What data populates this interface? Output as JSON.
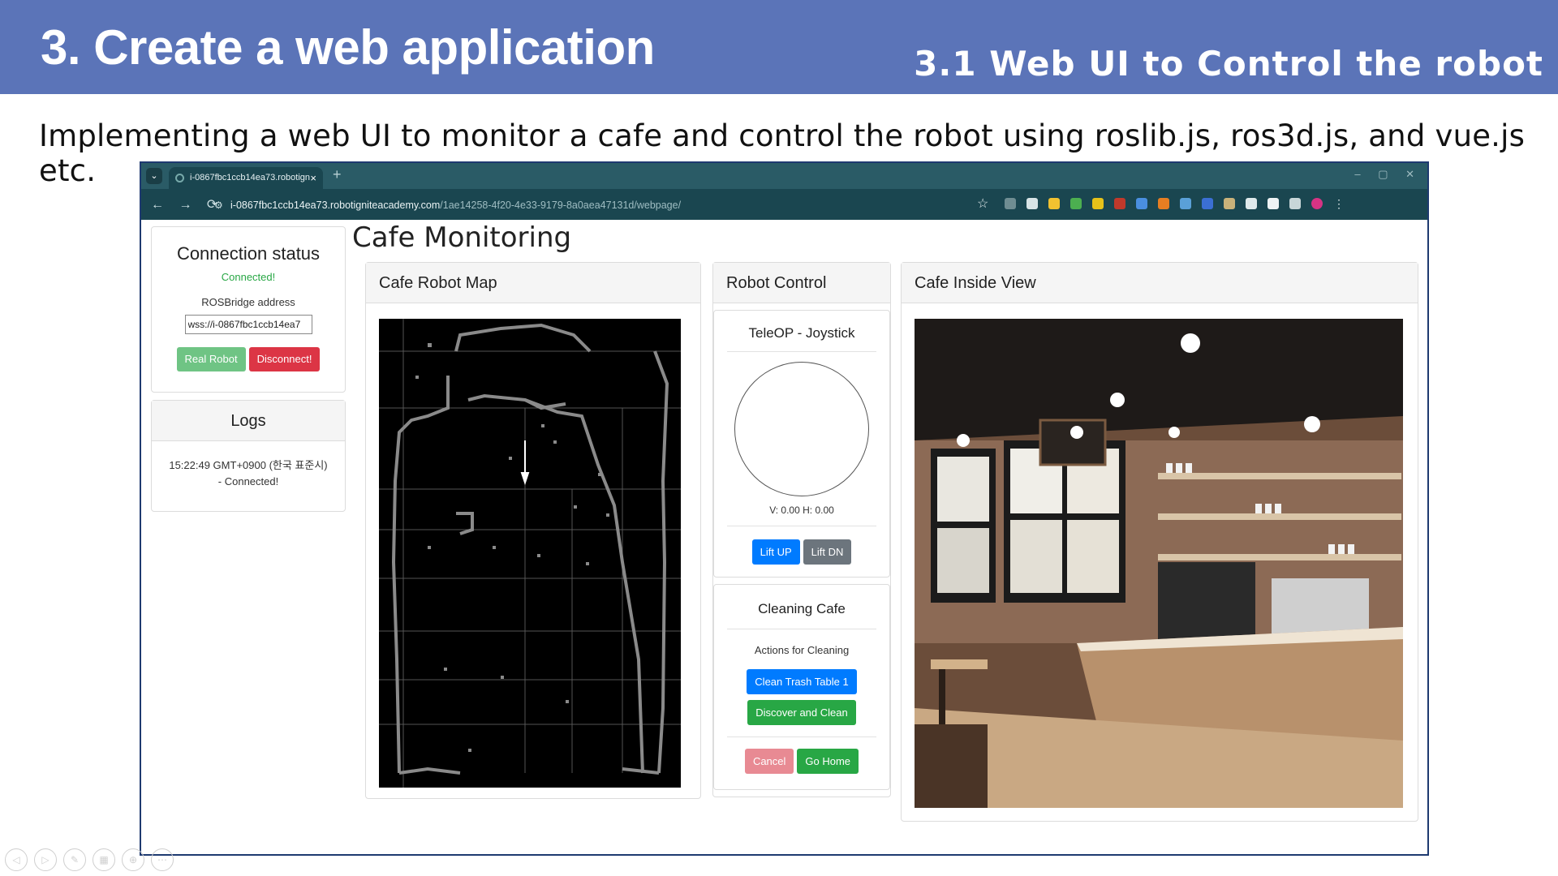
{
  "slide": {
    "title": "3. Create a web application",
    "subtitle": "3.1 Web UI to Control the robot",
    "description": "Implementing a web UI to monitor a cafe and control the robot using roslib.js, ros3d.js, and vue.js etc."
  },
  "browser": {
    "tab_title": "i-0867fbc1ccb14ea73.robotign",
    "tab_close": "×",
    "new_tab": "+",
    "window_controls": "– ▢ ✕",
    "nav": "← → ⟳",
    "url_host": "i-0867fbc1ccb14ea73.robotigniteacademy.com",
    "url_path": "/1ae14258-4f20-4e33-9179-8a0aea47131d/webpage/",
    "star": "☆"
  },
  "connection": {
    "title": "Connection status",
    "status": "Connected!",
    "rosbridge_label": "ROSBridge address",
    "rosbridge_value": "wss://i-0867fbc1ccb14ea7",
    "real_robot_button": "Real Robot",
    "disconnect_button": "Disconnect!"
  },
  "logs": {
    "title": "Logs",
    "line1": "15:22:49 GMT+0900 (한국 표준시)",
    "line2": "- Connected!"
  },
  "page": {
    "heading": "Cafe Monitoring"
  },
  "map": {
    "title": "Cafe Robot Map"
  },
  "control": {
    "title": "Robot Control",
    "teleop_title": "TeleOP - Joystick",
    "vh_readout": "V: 0.00 H: 0.00",
    "lift_up": "Lift UP",
    "lift_dn": "Lift DN",
    "cleaning_title": "Cleaning Cafe",
    "cleaning_sub": "Actions for Cleaning",
    "clean_trash": "Clean Trash Table 1",
    "discover_clean": "Discover and Clean",
    "cancel": "Cancel",
    "go_home": "Go Home"
  },
  "view": {
    "title": "Cafe Inside View"
  },
  "colors": {
    "header_bg": "#5b74b8",
    "connected": "#28a745",
    "primary": "#007bff",
    "danger": "#dc3545",
    "secondary": "#6c757d"
  }
}
